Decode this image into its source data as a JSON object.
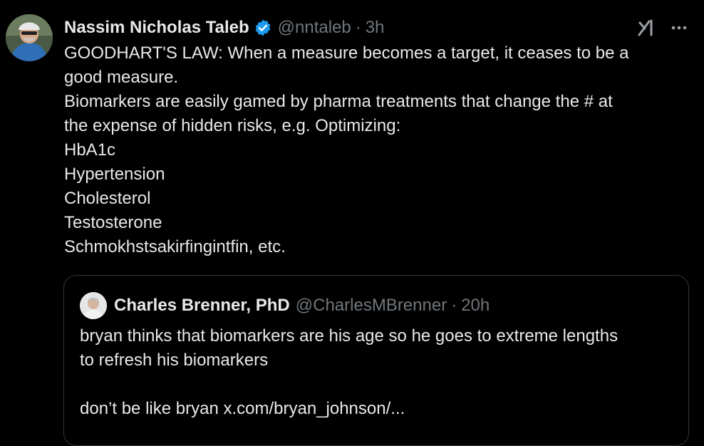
{
  "tweet": {
    "author": {
      "name": "Nassim Nicholas Taleb",
      "handle": "@nntaleb",
      "time": "3h",
      "separator": "·"
    },
    "icons": {
      "verified": "verified-badge-icon",
      "grok": "grok-icon",
      "more": "more-options-icon"
    },
    "lines": [
      "GOODHART'S LAW: When a measure becomes a target, it ceases to be a",
      "good measure.",
      "Biomarkers are easily gamed by pharma treatments that change the # at",
      "the expense of hidden risks, e.g. Optimizing:",
      "HbA1c",
      "Hypertension",
      "Cholesterol",
      "Testosterone",
      "Schmokhstsakirfingintfin, etc."
    ]
  },
  "quote": {
    "author": {
      "name": "Charles Brenner, PhD",
      "handle": "@CharlesMBrenner",
      "time": "20h",
      "separator": "·"
    },
    "lines": [
      "bryan thinks that biomarkers are his age so he goes to extreme lengths",
      "to refresh his biomarkers",
      "",
      "don’t be like bryan x.com/bryan_johnson/..."
    ]
  },
  "colors": {
    "background": "#000000",
    "primary_text": "#e7e9ea",
    "secondary_text": "#71767b",
    "verified_blue": "#1d9bf0",
    "border": "#333639"
  }
}
